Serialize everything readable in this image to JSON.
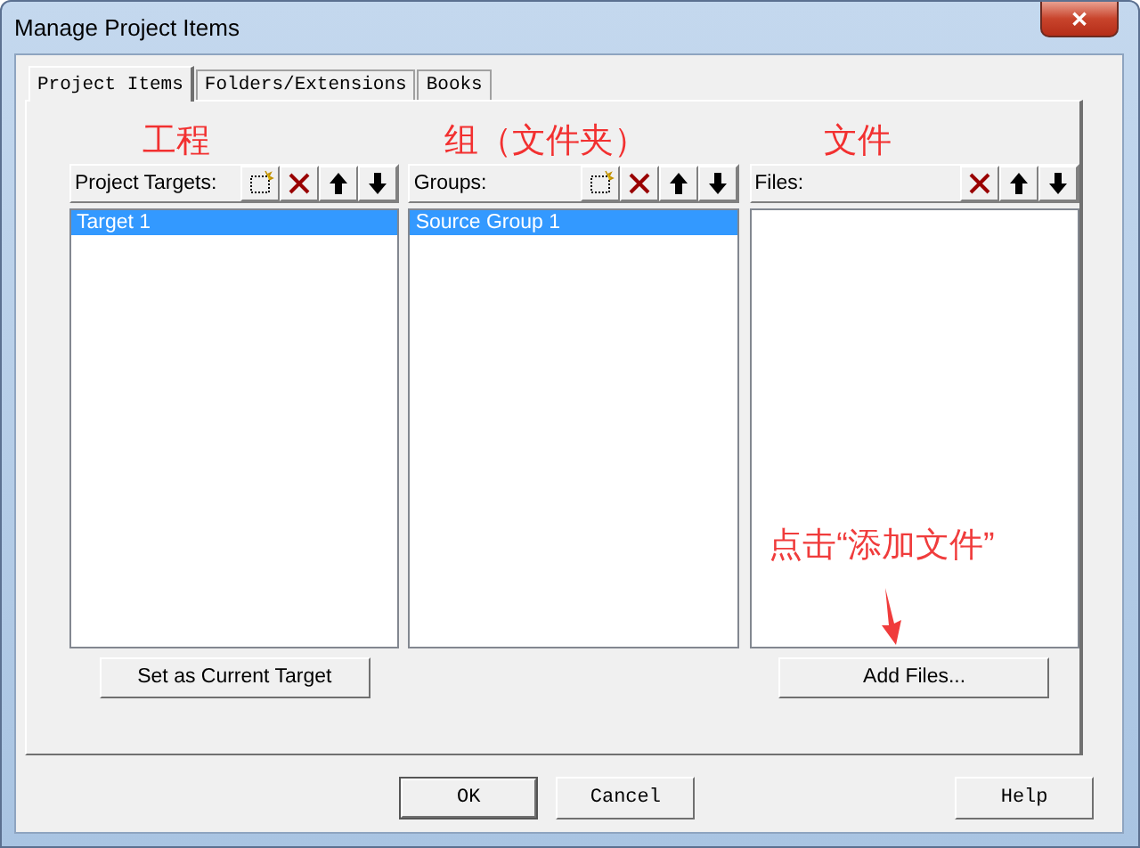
{
  "window": {
    "title": "Manage Project Items",
    "close": "✕"
  },
  "tabs": [
    {
      "label": "Project Items",
      "selected": true
    },
    {
      "label": "Folders/Extensions",
      "selected": false
    },
    {
      "label": "Books",
      "selected": false
    }
  ],
  "panels": [
    {
      "annotation": "工程",
      "label": "Project Targets:",
      "tools": [
        {
          "kind": "new"
        },
        {
          "kind": "delete"
        },
        {
          "kind": "up"
        },
        {
          "kind": "down"
        }
      ],
      "items": [
        {
          "text": "Target 1",
          "selected": true
        }
      ],
      "action": "Set as Current Target"
    },
    {
      "annotation": "组（文件夹）",
      "label": "Groups:",
      "tools": [
        {
          "kind": "new"
        },
        {
          "kind": "delete"
        },
        {
          "kind": "up"
        },
        {
          "kind": "down"
        }
      ],
      "items": [
        {
          "text": "Source Group 1",
          "selected": true
        }
      ]
    },
    {
      "annotation": "文件",
      "label": "Files:",
      "tools": [
        {
          "kind": "delete"
        },
        {
          "kind": "up"
        },
        {
          "kind": "down"
        }
      ],
      "action": "Add Files...",
      "note": "点击“添加文件”"
    }
  ],
  "buttons": [
    {
      "label": "OK",
      "default": true
    },
    {
      "label": "Cancel",
      "default": false
    },
    {
      "label": "Help",
      "default": false
    }
  ]
}
